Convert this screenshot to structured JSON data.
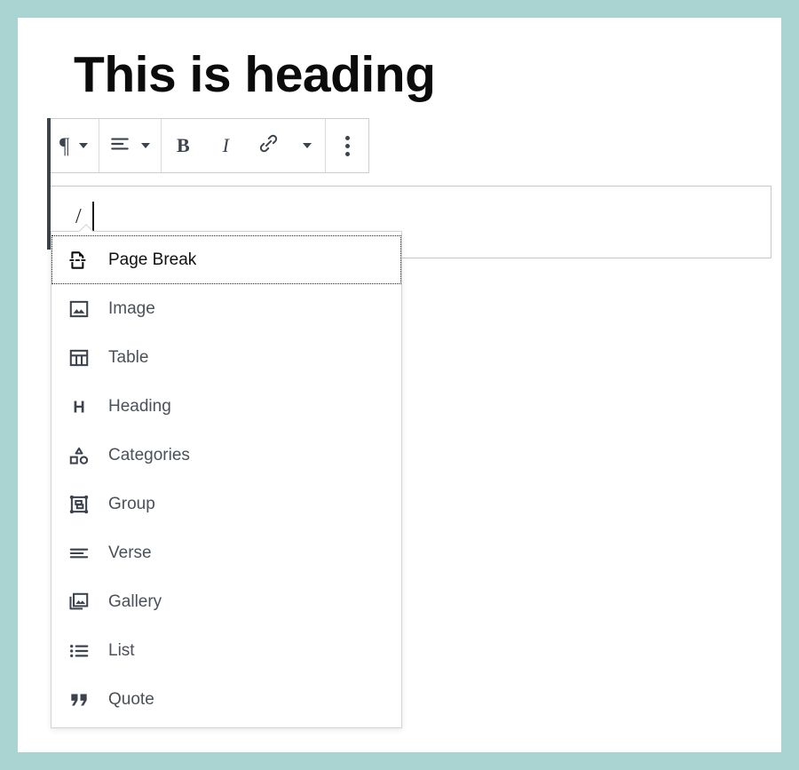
{
  "theme": {
    "frame_color": "#a9d4d2",
    "canvas_color": "#ffffff",
    "toolbar_icon_color": "#3c434d",
    "menu_text_color": "#4a5159",
    "focused_text_color": "#101010"
  },
  "document": {
    "heading": "This is heading"
  },
  "toolbar": {
    "groups": [
      {
        "name": "block-type-group",
        "buttons": [
          {
            "name": "paragraph-block-type",
            "icon": "pilcrow-icon",
            "glyph": "¶",
            "has_caret": true,
            "label": "Paragraph"
          }
        ]
      },
      {
        "name": "alignment-group",
        "buttons": [
          {
            "name": "align-text",
            "icon": "align-left-icon",
            "has_caret": true,
            "label": "Align text"
          }
        ]
      },
      {
        "name": "formatting-group",
        "buttons": [
          {
            "name": "bold-button",
            "icon": "bold-icon",
            "glyph": "B",
            "has_caret": false,
            "label": "Bold"
          },
          {
            "name": "italic-button",
            "icon": "italic-icon",
            "glyph": "I",
            "has_caret": false,
            "label": "Italic"
          },
          {
            "name": "link-button",
            "icon": "link-icon",
            "has_caret": false,
            "label": "Link"
          },
          {
            "name": "more-formatting",
            "icon": "chevron-down-icon",
            "has_caret": true,
            "label": "More rich text controls"
          }
        ]
      },
      {
        "name": "options-group",
        "buttons": [
          {
            "name": "more-options-button",
            "icon": "ellipsis-vertical-icon",
            "has_caret": false,
            "label": "Options"
          }
        ]
      }
    ]
  },
  "editor": {
    "paragraph_value": "/",
    "caret_visible": true
  },
  "slash_menu": {
    "focused_index": 0,
    "items": [
      {
        "label": "Page Break",
        "icon": "page-break-icon"
      },
      {
        "label": "Image",
        "icon": "image-icon"
      },
      {
        "label": "Table",
        "icon": "table-icon"
      },
      {
        "label": "Heading",
        "icon": "heading-icon"
      },
      {
        "label": "Categories",
        "icon": "categories-icon"
      },
      {
        "label": "Group",
        "icon": "group-icon"
      },
      {
        "label": "Verse",
        "icon": "verse-icon"
      },
      {
        "label": "Gallery",
        "icon": "gallery-icon"
      },
      {
        "label": "List",
        "icon": "list-icon"
      },
      {
        "label": "Quote",
        "icon": "quote-icon"
      }
    ]
  }
}
